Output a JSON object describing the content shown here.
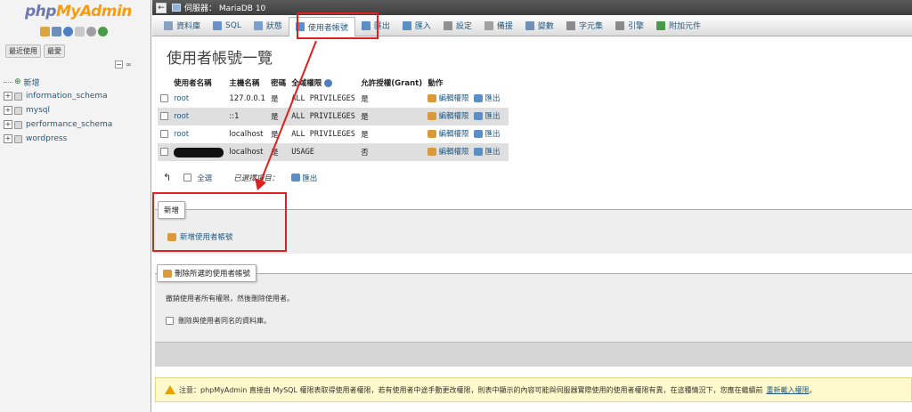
{
  "nav": {
    "logo_part1": "php",
    "logo_part2": "MyAdmin",
    "tabs": [
      "最近使用",
      "最愛"
    ],
    "tree": [
      {
        "label": "新增",
        "type": "new"
      },
      {
        "label": "information_schema",
        "type": "db"
      },
      {
        "label": "mysql",
        "type": "db"
      },
      {
        "label": "performance_schema",
        "type": "db"
      },
      {
        "label": "wordpress",
        "type": "db"
      }
    ]
  },
  "breadcrumb": {
    "server": "伺服器： MariaDB 10"
  },
  "menu": {
    "tabs": [
      {
        "label": "資料庫",
        "icon": "database-icon",
        "color": "#8aa0c0"
      },
      {
        "label": "SQL",
        "icon": "sql-icon",
        "color": "#6b8fc7"
      },
      {
        "label": "狀態",
        "icon": "status-icon",
        "color": "#7aa0d0"
      },
      {
        "label": "使用者帳號",
        "icon": "users-icon",
        "color": "#5a8fd0",
        "active": true
      },
      {
        "label": "匯出",
        "icon": "export-icon",
        "color": "#5c8ec6"
      },
      {
        "label": "匯入",
        "icon": "import-icon",
        "color": "#5c8ec6"
      },
      {
        "label": "設定",
        "icon": "wrench-icon",
        "color": "#909090"
      },
      {
        "label": "備援",
        "icon": "replication-icon",
        "color": "#a0a0a0"
      },
      {
        "label": "變數",
        "icon": "variables-icon",
        "color": "#6f8fb8"
      },
      {
        "label": "字元集",
        "icon": "charset-icon",
        "color": "#8a8a8a"
      },
      {
        "label": "引擎",
        "icon": "engine-icon",
        "color": "#8a8a8a"
      },
      {
        "label": "附加元件",
        "icon": "plugin-icon",
        "color": "#4a9a4a"
      }
    ]
  },
  "page": {
    "title": "使用者帳號一覽"
  },
  "users_table": {
    "headers": [
      "使用者名稱",
      "主機名稱",
      "密碼",
      "全域權限",
      "允許授權(Grant)",
      "動作"
    ],
    "rows": [
      {
        "user": "root",
        "host": "127.0.0.1",
        "password": "是",
        "privileges": "ALL PRIVILEGES",
        "grant": "是",
        "edit": "編輯權限",
        "export": "匯出"
      },
      {
        "user": "root",
        "host": "::1",
        "password": "是",
        "privileges": "ALL PRIVILEGES",
        "grant": "是",
        "edit": "編輯權限",
        "export": "匯出"
      },
      {
        "user": "root",
        "host": "localhost",
        "password": "是",
        "privileges": "ALL PRIVILEGES",
        "grant": "是",
        "edit": "編輯權限",
        "export": "匯出"
      },
      {
        "user": "",
        "host": "localhost",
        "password": "是",
        "privileges": "USAGE",
        "grant": "否",
        "edit": "編輯權限",
        "export": "匯出"
      }
    ]
  },
  "with_selected": {
    "check_all": "全選",
    "label": "已選擇項目：",
    "export": "匯出"
  },
  "new_section": {
    "legend": "新增",
    "add_user": "新增使用者帳號"
  },
  "delete_section": {
    "legend": "刪除所選的使用者帳號",
    "revoke_text": "撤銷使用者所有權限，然後刪除使用者。",
    "drop_db_label": "刪除與使用者同名的資料庫。"
  },
  "notice": {
    "text": "注意：phpMyAdmin 直接由 MySQL 權限表取得使用者權限，若有使用者中途手動更改權限，則表中顯示的內容可能與伺服器實際使用的使用者權限有異，在這種情況下，您應在繼續前",
    "link": "重新載入權限"
  },
  "colors": {
    "annotation_red": "#e0201e",
    "link": "#235a81",
    "orange": "#f89c0e"
  }
}
